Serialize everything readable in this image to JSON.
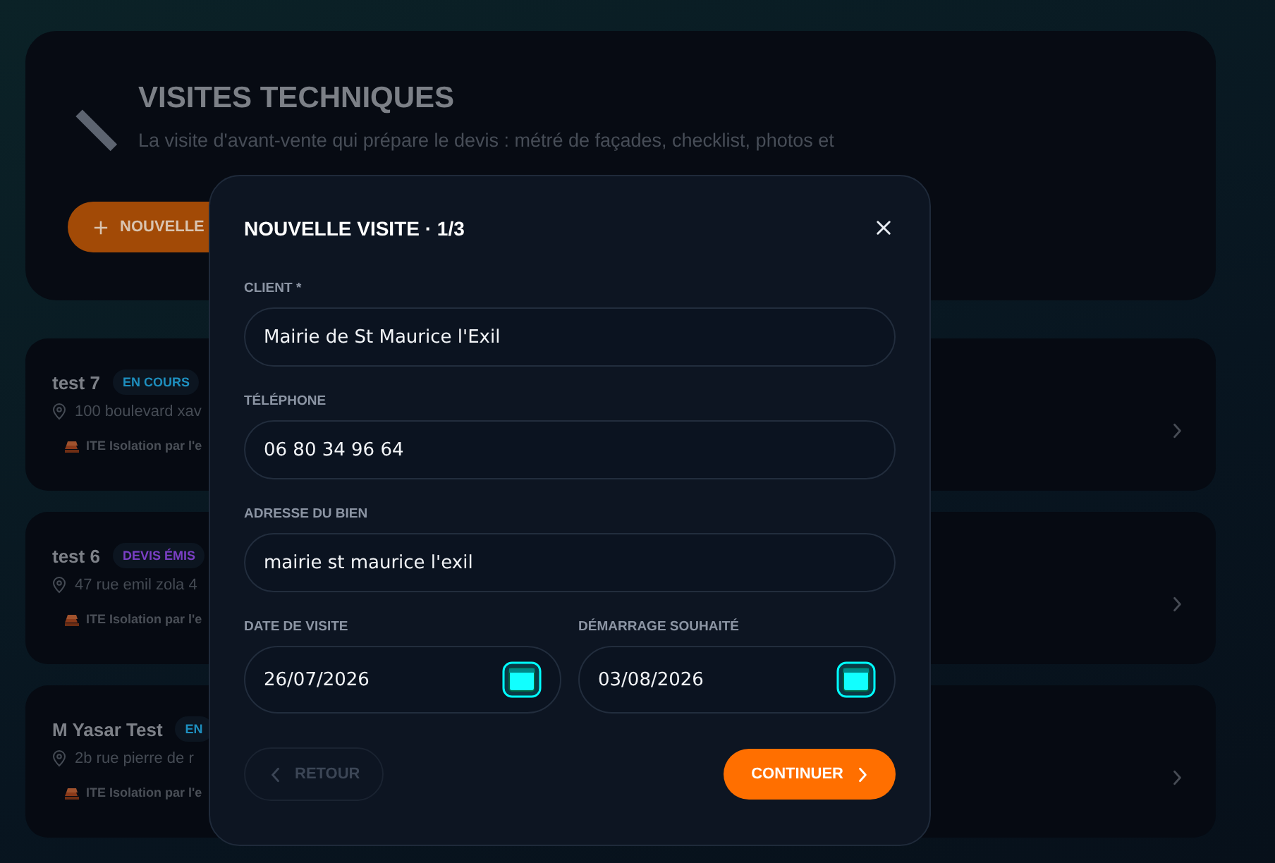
{
  "header": {
    "title": "VISITES TECHNIQUES",
    "description": "La visite d'avant-vente qui prépare le devis : métré de façades, checklist, photos et",
    "new_button": "NOUVELLE"
  },
  "visits": [
    {
      "name": "test 7",
      "status": "EN COURS",
      "color": "#1e8fbf",
      "address": "100 boulevard xav",
      "work": "ITE Isolation par l'e"
    },
    {
      "name": "test 6",
      "status": "DEVIS ÉMIS",
      "color": "#7a3fc4",
      "address": "47 rue emil zola 4",
      "work": "ITE Isolation par l'e"
    },
    {
      "name": "M Yasar Test",
      "status": "EN",
      "color": "#1e8fbf",
      "address": "2b rue pierre de r",
      "work": "ITE Isolation par l'e"
    }
  ],
  "dialog": {
    "title": "NOUVELLE VISITE · 1/3",
    "fields": [
      {
        "kind": "text",
        "label": "CLIENT *",
        "value": "Mairie de St Maurice l'Exil"
      },
      {
        "kind": "text",
        "label": "TÉLÉPHONE",
        "value": "06 80 34 96 64"
      },
      {
        "kind": "text",
        "label": "ADRESSE DU BIEN",
        "value": "mairie st maurice l'exil"
      }
    ],
    "dates": [
      {
        "kind": "date",
        "label": "DATE DE VISITE",
        "value": "26/07/2026"
      },
      {
        "kind": "date",
        "label": "DÉMARRAGE SOUHAITÉ",
        "value": "03/08/2026"
      }
    ],
    "back_button": {
      "label": "RETOUR",
      "disabled": true
    },
    "continue_button": {
      "label": "CONTINUER"
    }
  }
}
